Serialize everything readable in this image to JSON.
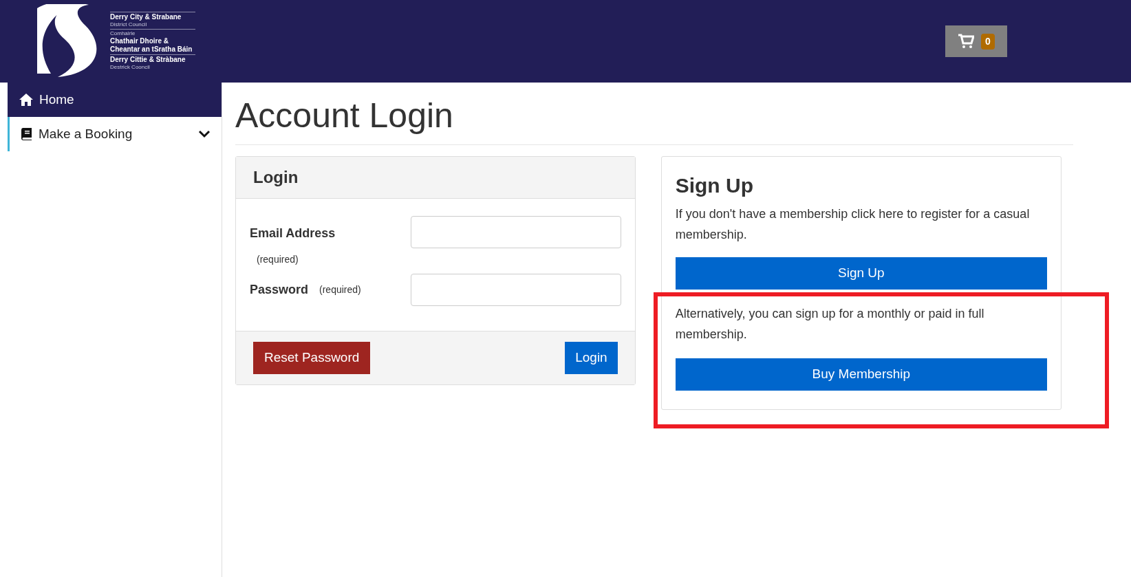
{
  "header": {
    "logo_lines": [
      {
        "text": "Derry City & Strabane",
        "kind": "bold"
      },
      {
        "text": "District Council",
        "kind": "small"
      },
      {
        "text": "Comhairle",
        "kind": "small"
      },
      {
        "text": "Chathair Dhoire &",
        "kind": "bold"
      },
      {
        "text": "Cheantar an tSratha Báin",
        "kind": "bold"
      },
      {
        "text": "Derry Cittie & Stràbane",
        "kind": "bold"
      },
      {
        "text": "Destrick Cooncil",
        "kind": "small"
      }
    ],
    "cart": {
      "count": "0"
    }
  },
  "sidebar": {
    "items": [
      {
        "label": "Home",
        "kind": "home",
        "selected": true
      },
      {
        "label": "Make a Booking",
        "kind": "book",
        "selected": false,
        "expanded": false
      }
    ]
  },
  "page_title": "Account Login",
  "login": {
    "title": "Login",
    "fields": [
      {
        "label": "Email Address",
        "note": "(required)",
        "kind": "below"
      },
      {
        "label": "Password",
        "note": "(required)",
        "kind": "inline"
      }
    ],
    "reset_button": "Reset Password",
    "login_button": "Login"
  },
  "signup": {
    "title": "Sign Up",
    "text": "If you don't have a membership click here to register for a casual membership.",
    "signup_button": "Sign Up",
    "alt_text": "Alternatively, you can sign up for a monthly or paid in full membership.",
    "membership_button": "Buy Membership"
  }
}
